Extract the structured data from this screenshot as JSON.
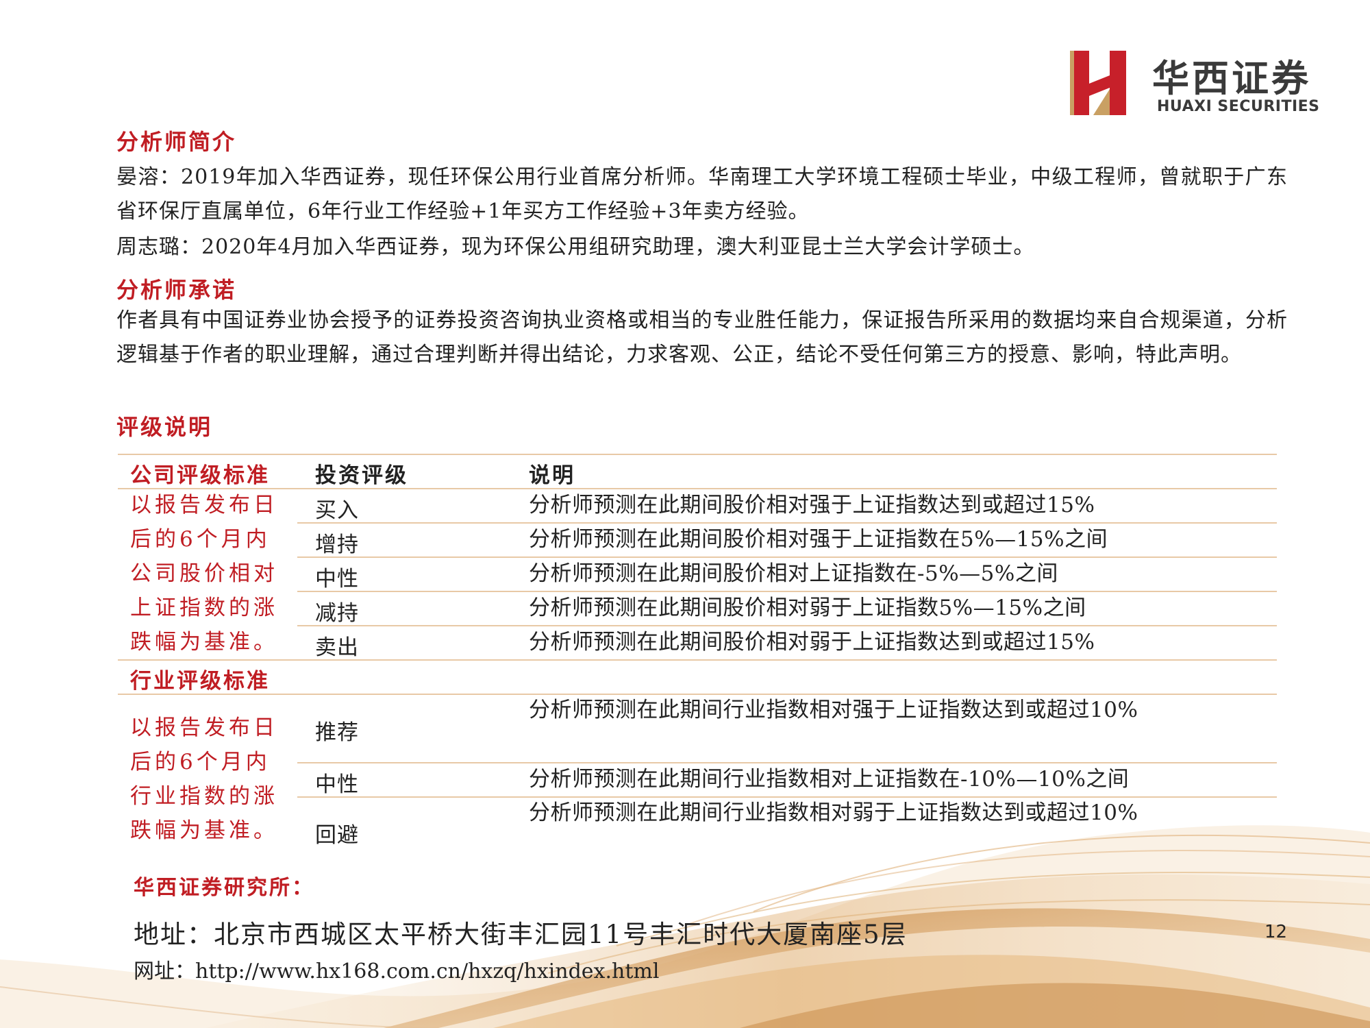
{
  "logo": {
    "name_cn": "华西证券",
    "name_en": "HUAXI SECURITIES"
  },
  "analyst_intro": {
    "heading": "分析师简介",
    "paragraphs": [
      "晏溶：2019年加入华西证券，现任环保公用行业首席分析师。华南理工大学环境工程硕士毕业，中级工程师，曾就职于广东省环保厅直属单位，6年行业工作经验+1年买方工作经验+3年卖方经验。",
      "周志璐：2020年4月加入华西证券，现为环保公用组研究助理，澳大利亚昆士兰大学会计学硕士。"
    ]
  },
  "analyst_commitment": {
    "heading": "分析师承诺",
    "text": "作者具有中国证券业协会授予的证券投资咨询执业资格或相当的专业胜任能力，保证报告所采用的数据均来自合规渠道，分析逻辑基于作者的职业理解，通过合理判断并得出结论，力求客观、公正，结论不受任何第三方的授意、影响，特此声明。"
  },
  "rating_explanation": {
    "heading": "评级说明",
    "table": {
      "headers": [
        "公司评级标准",
        "投资评级",
        "说明"
      ],
      "company_standard": "以报告发布日后的6个月内公司股价相对上证指数的涨跌幅为基准。",
      "company_rows": [
        {
          "rating": "买入",
          "desc": "分析师预测在此期间股价相对强于上证指数达到或超过15%"
        },
        {
          "rating": "增持",
          "desc": "分析师预测在此期间股价相对强于上证指数在5%—15%之间"
        },
        {
          "rating": "中性",
          "desc": "分析师预测在此期间股价相对上证指数在-5%—5%之间"
        },
        {
          "rating": "减持",
          "desc": "分析师预测在此期间股价相对弱于上证指数5%—15%之间"
        },
        {
          "rating": "卖出",
          "desc": "分析师预测在此期间股价相对弱于上证指数达到或超过15%"
        }
      ],
      "industry_header": "行业评级标准",
      "industry_standard": "以报告发布日后的6个月内行业指数的涨跌幅为基准。",
      "industry_rows": [
        {
          "rating": "推荐",
          "desc": "分析师预测在此期间行业指数相对强于上证指数达到或超过10%"
        },
        {
          "rating": "中性",
          "desc": "分析师预测在此期间行业指数相对上证指数在-10%—10%之间"
        },
        {
          "rating": "回避",
          "desc": "分析师预测在此期间行业指数相对弱于上证指数达到或超过10%"
        }
      ]
    }
  },
  "footer": {
    "institute": "华西证券研究所：",
    "address": "地址：北京市西城区太平桥大街丰汇园11号丰汇时代大厦南座5层",
    "website": "网址：http://www.hx168.com.cn/hxzq/hxindex.html",
    "page_number": "12"
  },
  "colors": {
    "accent_red": "#c01d23",
    "rule_line": "#e8c9a6",
    "wave_gold": "#d9a766"
  }
}
